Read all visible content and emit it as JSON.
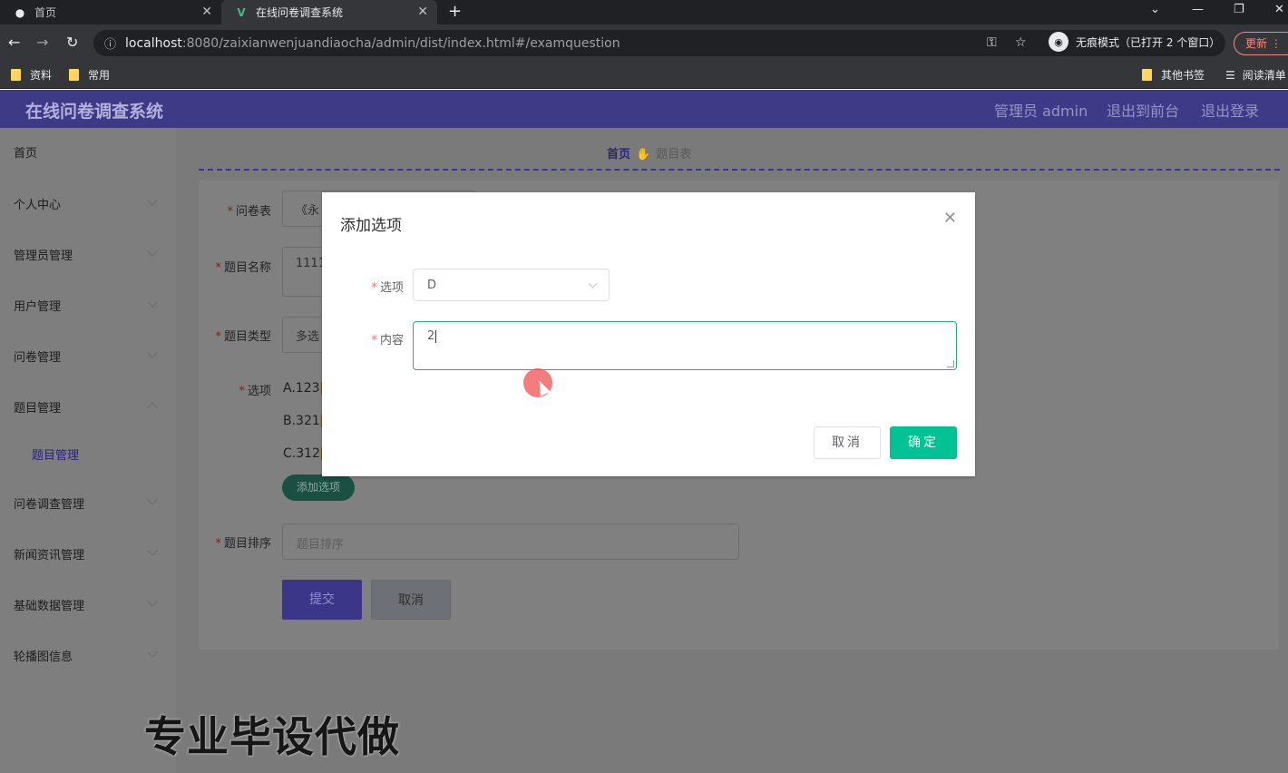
{
  "browser": {
    "tabs": [
      {
        "title": "首页",
        "icon": "globe-icon"
      },
      {
        "title": "在线问卷调查系统",
        "icon": "vue-logo-icon"
      }
    ],
    "url_host": "localhost",
    "url_path": ":8080/zaixianwenjuandiaocha/admin/dist/index.html#/examquestion",
    "incognito_label": "无痕模式（已打开 2 个窗口）",
    "update_label": "更新",
    "bookmarks": [
      "资料",
      "常用"
    ],
    "other_bookmarks": "其他书签",
    "reading_list": "阅读清单"
  },
  "header": {
    "title": "在线问卷调查系统",
    "user": "管理员 admin",
    "to_front": "退出到前台",
    "logout": "退出登录"
  },
  "sidebar": {
    "items": [
      {
        "label": "首页"
      },
      {
        "label": "个人中心"
      },
      {
        "label": "管理员管理"
      },
      {
        "label": "用户管理"
      },
      {
        "label": "问卷管理"
      },
      {
        "label": "题目管理"
      },
      {
        "label": "问卷调查管理"
      },
      {
        "label": "新闻资讯管理"
      },
      {
        "label": "基础数据管理"
      },
      {
        "label": "轮播图信息"
      }
    ],
    "sub_item": "题目管理"
  },
  "breadcrumb": {
    "home": "首页",
    "current": "题目表"
  },
  "form": {
    "survey_label": "问卷表",
    "survey_value": "《永",
    "name_label": "题目名称",
    "name_value": "1111",
    "type_label": "题目类型",
    "type_value": "多选",
    "options_label": "选项",
    "options": [
      "A.123",
      "B.321",
      "C.312"
    ],
    "add_option": "添加选项",
    "order_label": "题目排序",
    "order_placeholder": "题目排序",
    "submit": "提交",
    "cancel": "取消"
  },
  "dialog": {
    "title": "添加选项",
    "option_label": "选项",
    "option_value": "D",
    "content_label": "内容",
    "content_value": "2",
    "cancel": "取消",
    "confirm": "确定"
  },
  "watermark": "专业毕设代做"
}
